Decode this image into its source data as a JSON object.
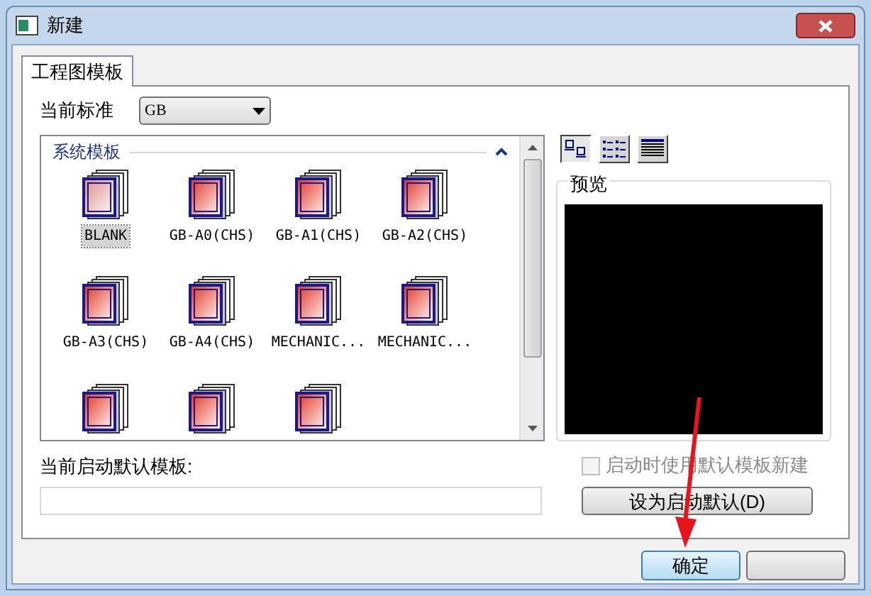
{
  "window": {
    "title": "新建"
  },
  "tabs": [
    {
      "label": "工程图模板",
      "selected": true
    }
  ],
  "standard": {
    "label": "当前标准",
    "value": "GB"
  },
  "view_modes": [
    {
      "kind": "large-icons",
      "selected": true
    },
    {
      "kind": "list",
      "selected": false
    },
    {
      "kind": "details",
      "selected": false
    }
  ],
  "template_group": {
    "title": "系统模板",
    "expanded": true
  },
  "templates": [
    {
      "label": "BLANK",
      "selected": true
    },
    {
      "label": "GB-A0(CHS)",
      "selected": false
    },
    {
      "label": "GB-A1(CHS)",
      "selected": false
    },
    {
      "label": "GB-A2(CHS)",
      "selected": false
    },
    {
      "label": "GB-A3(CHS)",
      "selected": false
    },
    {
      "label": "GB-A4(CHS)",
      "selected": false
    },
    {
      "label": "MECHANIC...",
      "selected": false
    },
    {
      "label": "MECHANIC...",
      "selected": false
    },
    {
      "selected": false
    },
    {
      "selected": false
    },
    {
      "selected": false
    }
  ],
  "preview": {
    "title": "预览"
  },
  "default_template": {
    "label": "当前启动默认模板:"
  },
  "use_default_on_start": {
    "label": "启动时使用默认模板新建",
    "checked": false,
    "disabled": true
  },
  "set_default_button": "设为启动默认(D)",
  "buttons": [
    {
      "label": "确定",
      "kind": "primary"
    },
    {
      "kind": "cancel"
    }
  ]
}
